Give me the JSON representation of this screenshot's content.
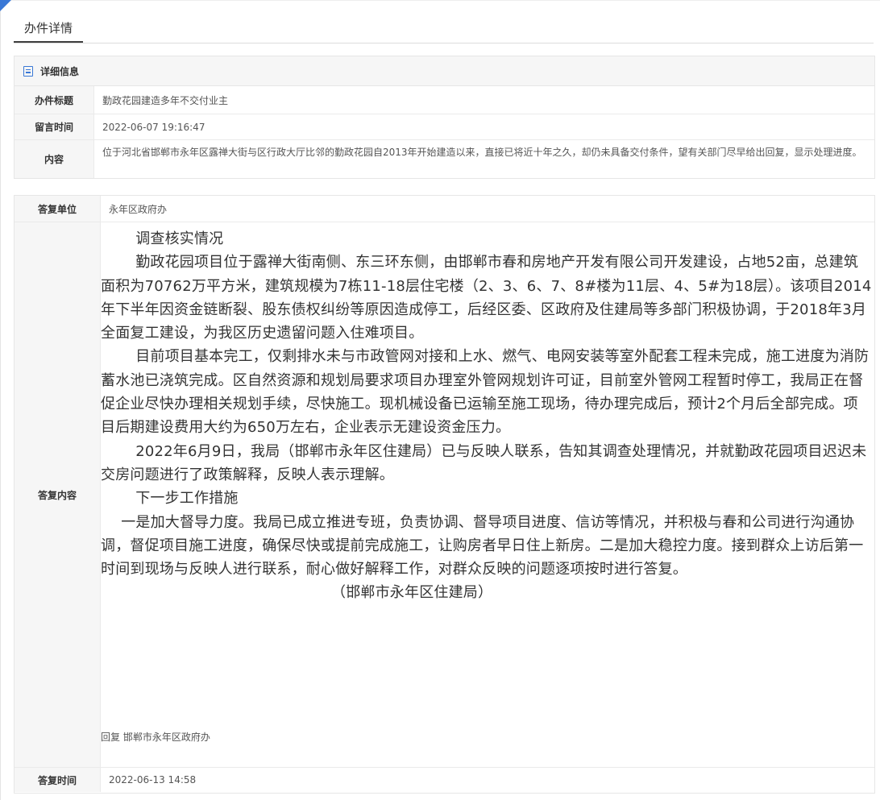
{
  "tab": {
    "label": "办件详情"
  },
  "detail_box": {
    "header": "详细信息",
    "icon": "document-list-icon",
    "rows": {
      "title": {
        "label": "办件标题",
        "value": "勤政花园建造多年不交付业主"
      },
      "time": {
        "label": "留言时间",
        "value": "2022-06-07 19:16:47"
      },
      "content": {
        "label": "内容",
        "value": "位于河北省邯郸市永年区露禅大街与区行政大厅比邻的勤政花园自2013年开始建造以来，直接已将近十年之久，却仍未具备交付条件，望有关部门尽早给出回复，显示处理进度。"
      }
    }
  },
  "reply_box": {
    "unit": {
      "label": "答复单位",
      "value": "永年区政府办"
    },
    "content": {
      "label": "答复内容",
      "paragraphs": {
        "p1": "调查核实情况",
        "p2": "勤政花园项目位于露禅大街南侧、东三环东侧，由邯郸市春和房地产开发有限公司开发建设，占地52亩，总建筑面积为70762万平方米，建筑规模为7栋11-18层住宅楼（2、3、6、7、8#楼为11层、4、5#为18层）。该项目2014年下半年因资金链断裂、股东债权纠纷等原因造成停工，后经区委、区政府及住建局等多部门积极协调，于2018年3月全面复工建设，为我区历史遗留问题入住难项目。",
        "p3": "目前项目基本完工，仅剩排水未与市政管网对接和上水、燃气、电网安装等室外配套工程未完成，施工进度为消防蓄水池已浇筑完成。区自然资源和规划局要求项目办理室外管网规划许可证，目前室外管网工程暂时停工，我局正在督促企业尽快办理相关规划手续，尽快施工。现机械设备已运输至施工现场，待办理完成后，预计2个月后全部完成。项目后期建设费用大约为650万左右，企业表示无建设资金压力。",
        "p4": "2022年6月9日，我局（邯郸市永年区住建局）已与反映人联系，告知其调查处理情况，并就勤政花园项目迟迟未交房问题进行了政策解释，反映人表示理解。",
        "p5": "下一步工作措施",
        "p6": "一是加大督导力度。我局已成立推进专班，负责协调、督导项目进度、信访等情况，并积极与春和公司进行沟通协调，督促项目施工进度，确保尽快或提前完成施工，让购房者早日住上新房。二是加大稳控力度。接到群众上访后第一时间到现场与反映人进行联系，耐心做好解释工作，对群众反映的问题逐项按时进行答复。",
        "p7": "（邯郸市永年区住建局）"
      },
      "footer": "回复 邯郸市永年区政府办"
    },
    "time": {
      "label": "答复时间",
      "value": "2022-06-13 14:58"
    }
  },
  "colors": {
    "accent": "#3a78d6",
    "label_bg": "#f6f6f6",
    "border": "#e6e6e6"
  }
}
